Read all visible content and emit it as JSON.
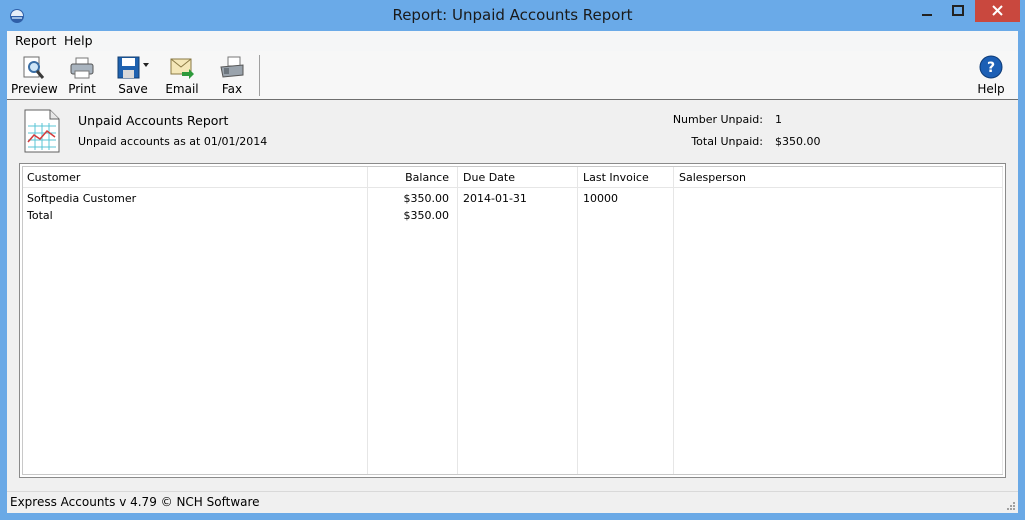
{
  "window": {
    "title": "Report: Unpaid Accounts Report",
    "colors": {
      "titlebar": "#6aaae8",
      "close": "#c9483e"
    }
  },
  "menu": {
    "items": [
      {
        "label": "Report"
      },
      {
        "label": "Help"
      }
    ]
  },
  "toolbar": {
    "preview_label": "Preview",
    "print_label": "Print",
    "save_label": "Save",
    "email_label": "Email",
    "fax_label": "Fax",
    "help_label": "Help"
  },
  "report": {
    "title": "Unpaid Accounts Report",
    "subtitle": "Unpaid accounts as at 01/01/2014",
    "number_unpaid_label": "Number Unpaid:",
    "number_unpaid_value": "1",
    "total_unpaid_label": "Total Unpaid:",
    "total_unpaid_value": "$350.00"
  },
  "table": {
    "columns": [
      "Customer",
      "Balance",
      "Due Date",
      "Last Invoice",
      "Salesperson"
    ],
    "rows": [
      {
        "customer": "Softpedia Customer",
        "balance": "$350.00",
        "due_date": "2014-01-31",
        "last_invoice": "10000",
        "salesperson": ""
      },
      {
        "customer": "Total",
        "balance": "$350.00",
        "due_date": "",
        "last_invoice": "",
        "salesperson": ""
      }
    ]
  },
  "status": {
    "text": "Express Accounts v 4.79 © NCH Software"
  }
}
